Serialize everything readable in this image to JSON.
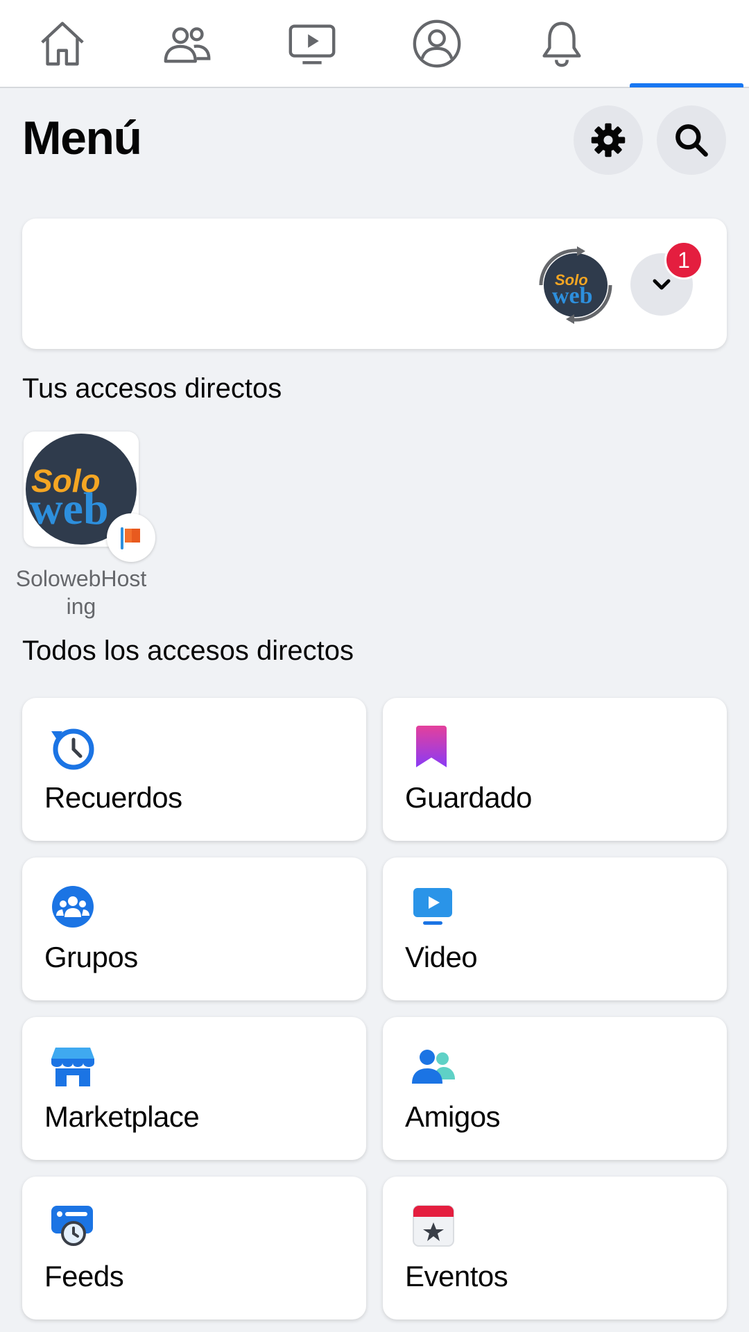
{
  "nav": {
    "tabs": [
      {
        "name": "home-icon"
      },
      {
        "name": "friends-icon"
      },
      {
        "name": "video-icon"
      },
      {
        "name": "profile-icon"
      },
      {
        "name": "bell-icon"
      },
      {
        "name": "menu-tab"
      }
    ],
    "active_color": "#1877f2"
  },
  "header": {
    "title": "Menú",
    "settings_icon": "gear-icon",
    "search_icon": "search-icon"
  },
  "profile": {
    "badge_count": "1",
    "avatar": "soloweb-logo",
    "switch_icon": "chevron-down-icon"
  },
  "shortcuts": {
    "heading": "Tus accesos directos",
    "items": [
      {
        "label": "SolowebHosting"
      }
    ]
  },
  "all_shortcuts": {
    "heading": "Todos los accesos directos",
    "items": [
      {
        "label": "Recuerdos",
        "icon": "memories-icon"
      },
      {
        "label": "Guardado",
        "icon": "bookmark-icon"
      },
      {
        "label": "Grupos",
        "icon": "groups-icon"
      },
      {
        "label": "Video",
        "icon": "video-tv-icon"
      },
      {
        "label": "Marketplace",
        "icon": "store-icon"
      },
      {
        "label": "Amigos",
        "icon": "friends-icon"
      },
      {
        "label": "Feeds",
        "icon": "feeds-icon"
      },
      {
        "label": "Eventos",
        "icon": "calendar-icon"
      }
    ]
  },
  "colors": {
    "background": "#f0f2f5",
    "badge": "#e41e3f",
    "accent": "#1877f2"
  }
}
